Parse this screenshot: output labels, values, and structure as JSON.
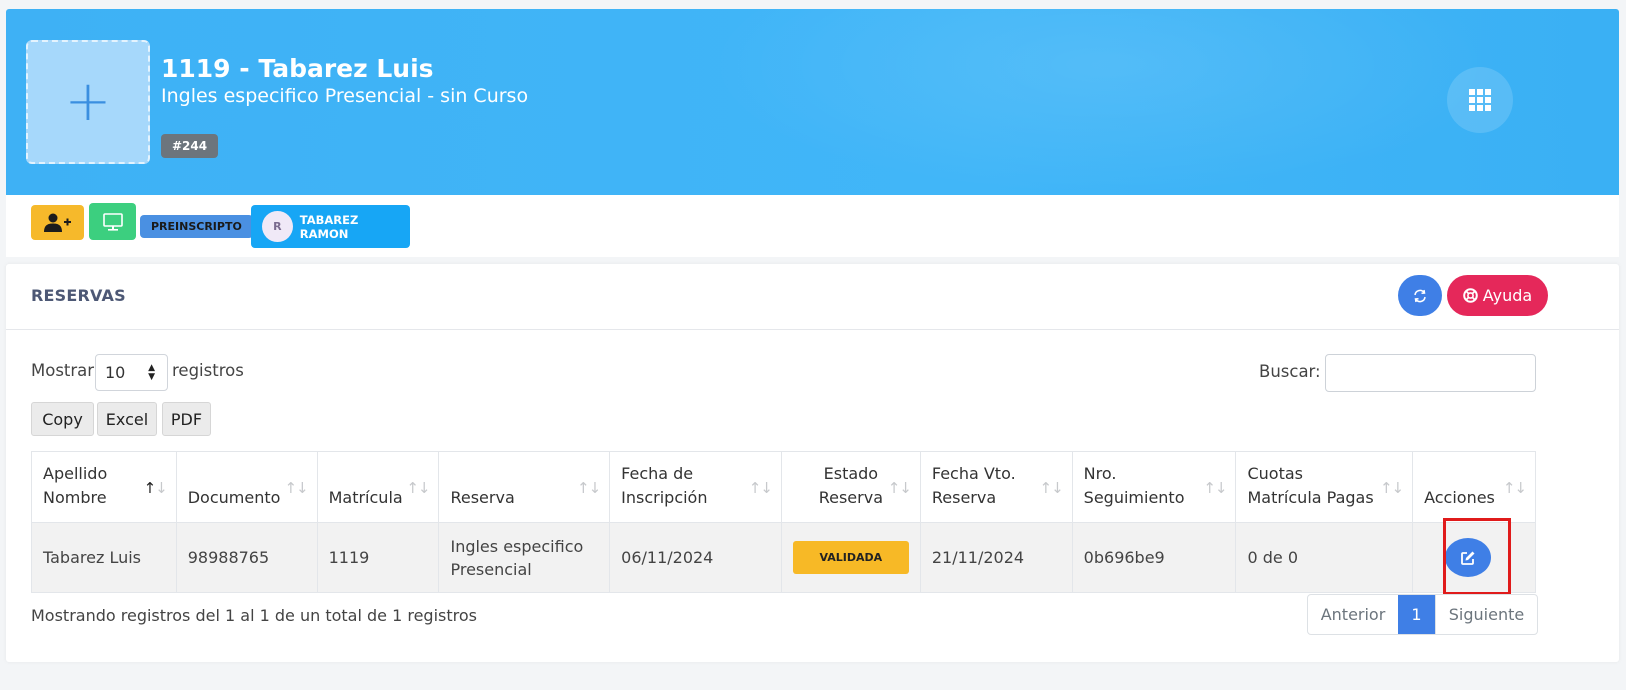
{
  "header": {
    "title": "1119 - Tabarez Luis",
    "subtitle": "Ingles especifico Presencial - sin Curso",
    "badge": "#244",
    "photo_placeholder": "+"
  },
  "toolbar": {
    "status_pill": "PREINSCRIPTO",
    "person": {
      "initial": "R",
      "name": "TABAREZ RAMON"
    }
  },
  "card": {
    "title": "RESERVAS",
    "help_label": "Ayuda",
    "show_label": "Mostrar",
    "page_size": "10",
    "records_label": "registros",
    "search_label": "Buscar:",
    "search_value": "",
    "export_buttons": [
      "Copy",
      "Excel",
      "PDF"
    ]
  },
  "table": {
    "columns": [
      {
        "l1": "Apellido",
        "l2": "Nombre"
      },
      {
        "l1": "",
        "l2": "Documento"
      },
      {
        "l1": "",
        "l2": "Matrícula"
      },
      {
        "l1": "",
        "l2": "Reserva"
      },
      {
        "l1": "Fecha de",
        "l2": "Inscripción"
      },
      {
        "l1": "Estado",
        "l2": "Reserva"
      },
      {
        "l1": "Fecha Vto.",
        "l2": "Reserva"
      },
      {
        "l1": "Nro.",
        "l2": "Seguimiento"
      },
      {
        "l1": "Cuotas",
        "l2": "Matrícula Pagas"
      },
      {
        "l1": "",
        "l2": "Acciones"
      }
    ],
    "rows": [
      {
        "nombre": "Tabarez Luis",
        "documento": "98988765",
        "matricula": "1119",
        "reserva_l1": "Ingles especifico",
        "reserva_l2": "Presencial",
        "fecha_inscripcion": "06/11/2024",
        "estado": "VALIDADA",
        "fecha_vto": "21/11/2024",
        "seguimiento": "0b696be9",
        "cuotas": "0 de 0"
      }
    ]
  },
  "footer": {
    "info": "Mostrando registros del 1 al 1 de un total de 1 registros",
    "prev": "Anterior",
    "page": "1",
    "next": "Siguiente"
  },
  "colors": {
    "header_bg": "#41b6f8",
    "primary": "#3f7fe6",
    "help": "#e5285a",
    "warning": "#f7b926",
    "success": "#3ccf7f",
    "highlight": "#e01b1b"
  },
  "icons": [
    "plus-icon",
    "grid-icon",
    "add-user-icon",
    "monitor-icon",
    "refresh-icon",
    "lifebuoy-icon",
    "sort-icon",
    "edit-icon"
  ]
}
